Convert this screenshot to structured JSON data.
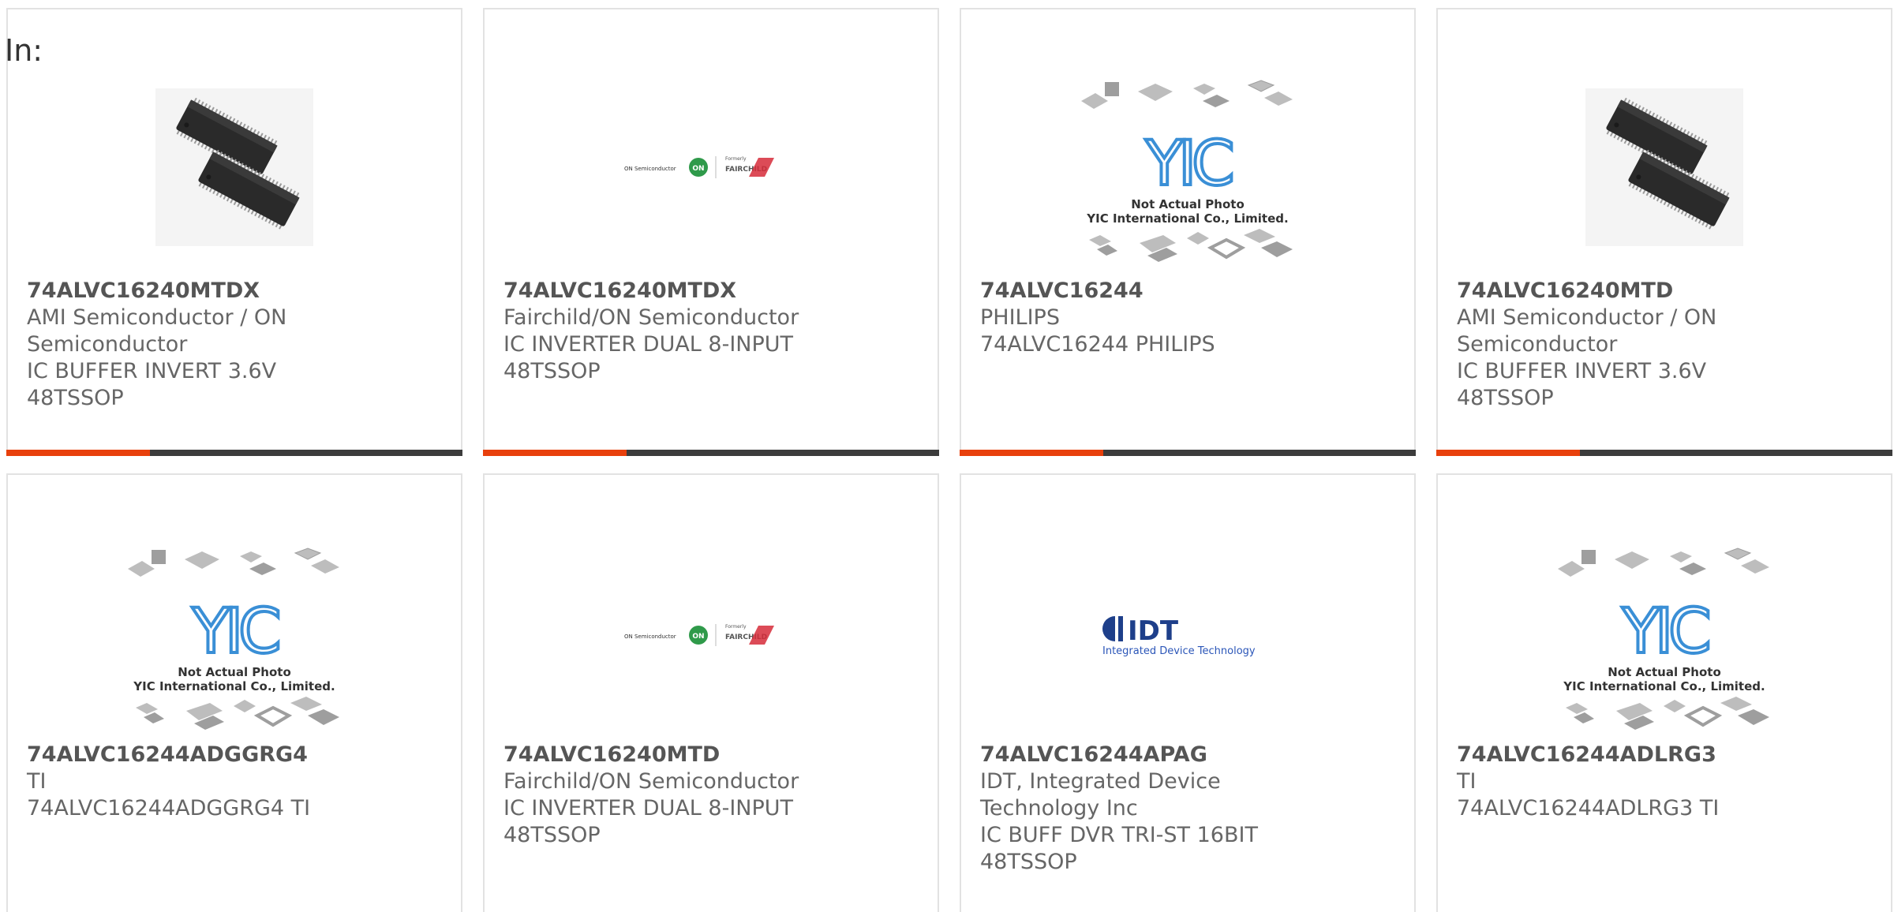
{
  "header": {
    "in_label": "In:"
  },
  "colors": {
    "accent": "#e8400c",
    "bar": "#3c3c3c",
    "border": "#e2e2e2",
    "yic_blue": "#3a8fd6"
  },
  "products": [
    {
      "part": "74ALVC16240MTDX",
      "manufacturer_lines": [
        "AMI Semiconductor / ON",
        "Semiconductor"
      ],
      "description_lines": [
        "IC BUFFER INVERT 3.6V",
        "48TSSOP"
      ],
      "image": "chip-photo-icon"
    },
    {
      "part": "74ALVC16240MTDX",
      "manufacturer_lines": [
        "Fairchild/ON Semiconductor"
      ],
      "description_lines": [
        "IC INVERTER DUAL 8-INPUT",
        "48TSSOP"
      ],
      "image": "on-fairchild-logo",
      "logo_text": {
        "on_small": "ON Semiconductor",
        "on_badge": "ON",
        "formerly": "Formerly",
        "fairchild": "FAIRCHILD"
      }
    },
    {
      "part": "74ALVC16244",
      "manufacturer_lines": [
        "PHILIPS"
      ],
      "description_lines": [
        "74ALVC16244 PHILIPS"
      ],
      "image": "yic-placeholder-icon",
      "placeholder_text": {
        "brand": "YIC",
        "line1": "Not Actual Photo",
        "line2": "YIC International Co., Limited."
      }
    },
    {
      "part": "74ALVC16240MTD",
      "manufacturer_lines": [
        "AMI Semiconductor / ON",
        "Semiconductor"
      ],
      "description_lines": [
        "IC BUFFER INVERT 3.6V",
        "48TSSOP"
      ],
      "image": "chip-photo-icon"
    },
    {
      "part": "74ALVC16244ADGGRG4",
      "manufacturer_lines": [
        "TI"
      ],
      "description_lines": [
        "74ALVC16244ADGGRG4 TI"
      ],
      "image": "yic-placeholder-icon",
      "placeholder_text": {
        "brand": "YIC",
        "line1": "Not Actual Photo",
        "line2": "YIC International Co., Limited."
      }
    },
    {
      "part": "74ALVC16240MTD",
      "manufacturer_lines": [
        "Fairchild/ON Semiconductor"
      ],
      "description_lines": [
        "IC INVERTER DUAL 8-INPUT",
        "48TSSOP"
      ],
      "image": "on-fairchild-logo",
      "logo_text": {
        "on_small": "ON Semiconductor",
        "on_badge": "ON",
        "formerly": "Formerly",
        "fairchild": "FAIRCHILD"
      }
    },
    {
      "part": "74ALVC16244APAG",
      "manufacturer_lines": [
        "IDT, Integrated Device",
        "Technology Inc"
      ],
      "description_lines": [
        "IC BUFF DVR TRI-ST 16BIT",
        "48TSSOP"
      ],
      "image": "idt-logo",
      "logo_text": {
        "brand": "IDT",
        "tagline": "Integrated Device Technology"
      }
    },
    {
      "part": "74ALVC16244ADLRG3",
      "manufacturer_lines": [
        "TI"
      ],
      "description_lines": [
        "74ALVC16244ADLRG3 TI"
      ],
      "image": "yic-placeholder-icon",
      "placeholder_text": {
        "brand": "YIC",
        "line1": "Not Actual Photo",
        "line2": "YIC International Co., Limited."
      }
    }
  ]
}
